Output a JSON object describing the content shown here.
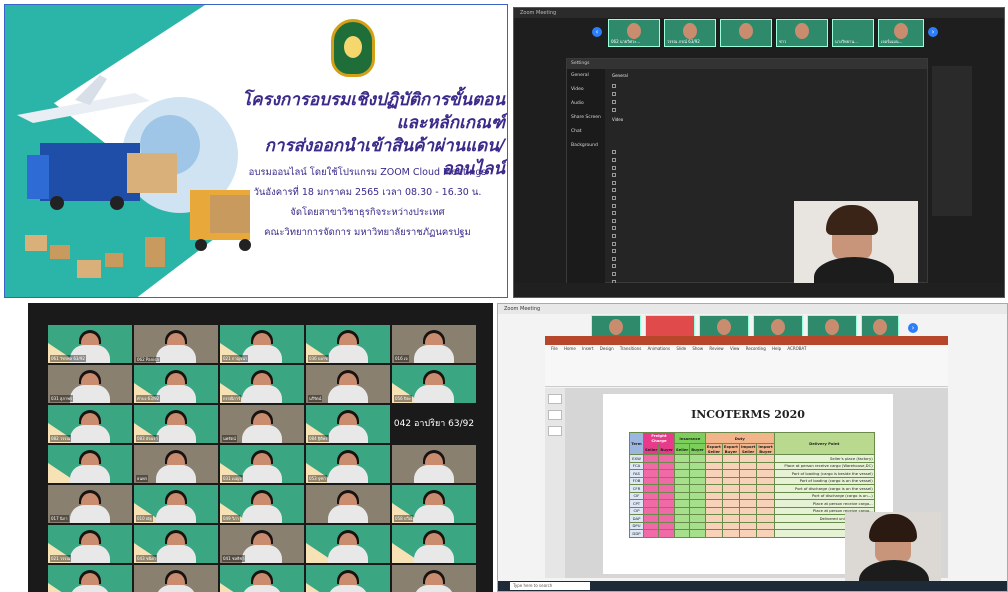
{
  "panel1": {
    "title_line1": "โครงการอบรมเชิงปฏิบัติการขั้นตอนและหลักเกณฑ์",
    "title_line2": "การส่งออกนำเข้าสินค้าผ่านแดน/ออนไลน์",
    "info_line1": "อบรมออนไลน์ โดยใช้โปรแกรม ZOOM Cloud Meetings",
    "info_line2": "วันอังคารที่ 18 มกราคม 2565  เวลา 08.30 - 16.30 น.",
    "info_line3": "จัดโดยสาขาวิชาธุรกิจระหว่างประเทศ",
    "info_line4": "คณะวิทยาการจัดการ มหาวิทยาลัยราชภัฏนครปฐม",
    "colors": {
      "teal": "#2bb5a8",
      "ink": "#3b2a8a",
      "border": "#3a63c8"
    }
  },
  "panel2": {
    "window_title": "Zoom Meeting",
    "settings_title": "Settings",
    "sidebar": [
      "General",
      "Video",
      "Audio",
      "Share Screen",
      "Chat",
      "Background"
    ],
    "section_general": "General",
    "section_video": "Video",
    "thumb_names": [
      "062 นายวิศวะ...",
      "วรรณ ภรณ์ 63/92",
      "",
      "ชาว",
      "นางวิทยาน...",
      "เจอร์มเมน..."
    ]
  },
  "panel3": {
    "label_tile": "042 อาปริยา 63/92",
    "tile_names": [
      "061 วัชรพล 63/92",
      "062 Panisa",
      "021 กาญจนา",
      "036 บงกช",
      "016 เจ",
      "031 สุภาพร",
      "คำบง 63/92",
      "กรรณิการ์",
      "นรีรัตน์",
      "056 ปิยะ",
      "082 วรรณ",
      "083 อัจฉรา",
      "นพรัตน์",
      "084 ฐิติพร",
      "",
      "ธนพร",
      "031 เบญจ",
      "053 จุฑา",
      "",
      "017 นิภา",
      "010 ณัฐ",
      "049 วิภา",
      "",
      "058 ปวีณ์",
      "021 วรรณ",
      "043 ชนิดา",
      "041 ชลธิชา",
      "",
      "",
      "011 กมล",
      "019 พีระพงษ์",
      "061 อรทัย",
      "",
      "",
      "073 วิภาวรรณ"
    ]
  },
  "panel4": {
    "window_title": "Zoom Meeting",
    "ppt_title": "INCOTERMS 2020",
    "ribbon_tabs": [
      "File",
      "Home",
      "Insert",
      "Design",
      "Transitions",
      "Animations",
      "Slide Show",
      "Review",
      "View",
      "Recording",
      "Help",
      "ACROBAT"
    ],
    "table_headers": [
      "Term",
      "Freight Charge",
      "Insurance",
      "Duty",
      "Delivery Point"
    ],
    "sub_headers": [
      "Seller",
      "Buyer",
      "Seller",
      "Buyer",
      "Export Seller",
      "Export Buyer",
      "Import Seller",
      "Import Buyer"
    ],
    "terms": [
      "EXW",
      "FCA",
      "FAS",
      "FOB",
      "CFR",
      "CIF",
      "CPT",
      "CIP",
      "DAP",
      "DPU",
      "DDP"
    ],
    "delivery": [
      "Seller's place (factory)",
      "Place at person receive cargo (Warehouse,DC)",
      "Port of loading (cargo is beside the vessel)",
      "Port of loading (cargo is on the vessel)",
      "Port of discharge (cargo is on the vessel)",
      "Port of discharge (cargo is on...)",
      "Place at person receive cargo...",
      "Place at person receive cargo...",
      "Delivered unloaded at the...",
      "Destination",
      "Destination"
    ],
    "search_placeholder": "Type here to search"
  }
}
